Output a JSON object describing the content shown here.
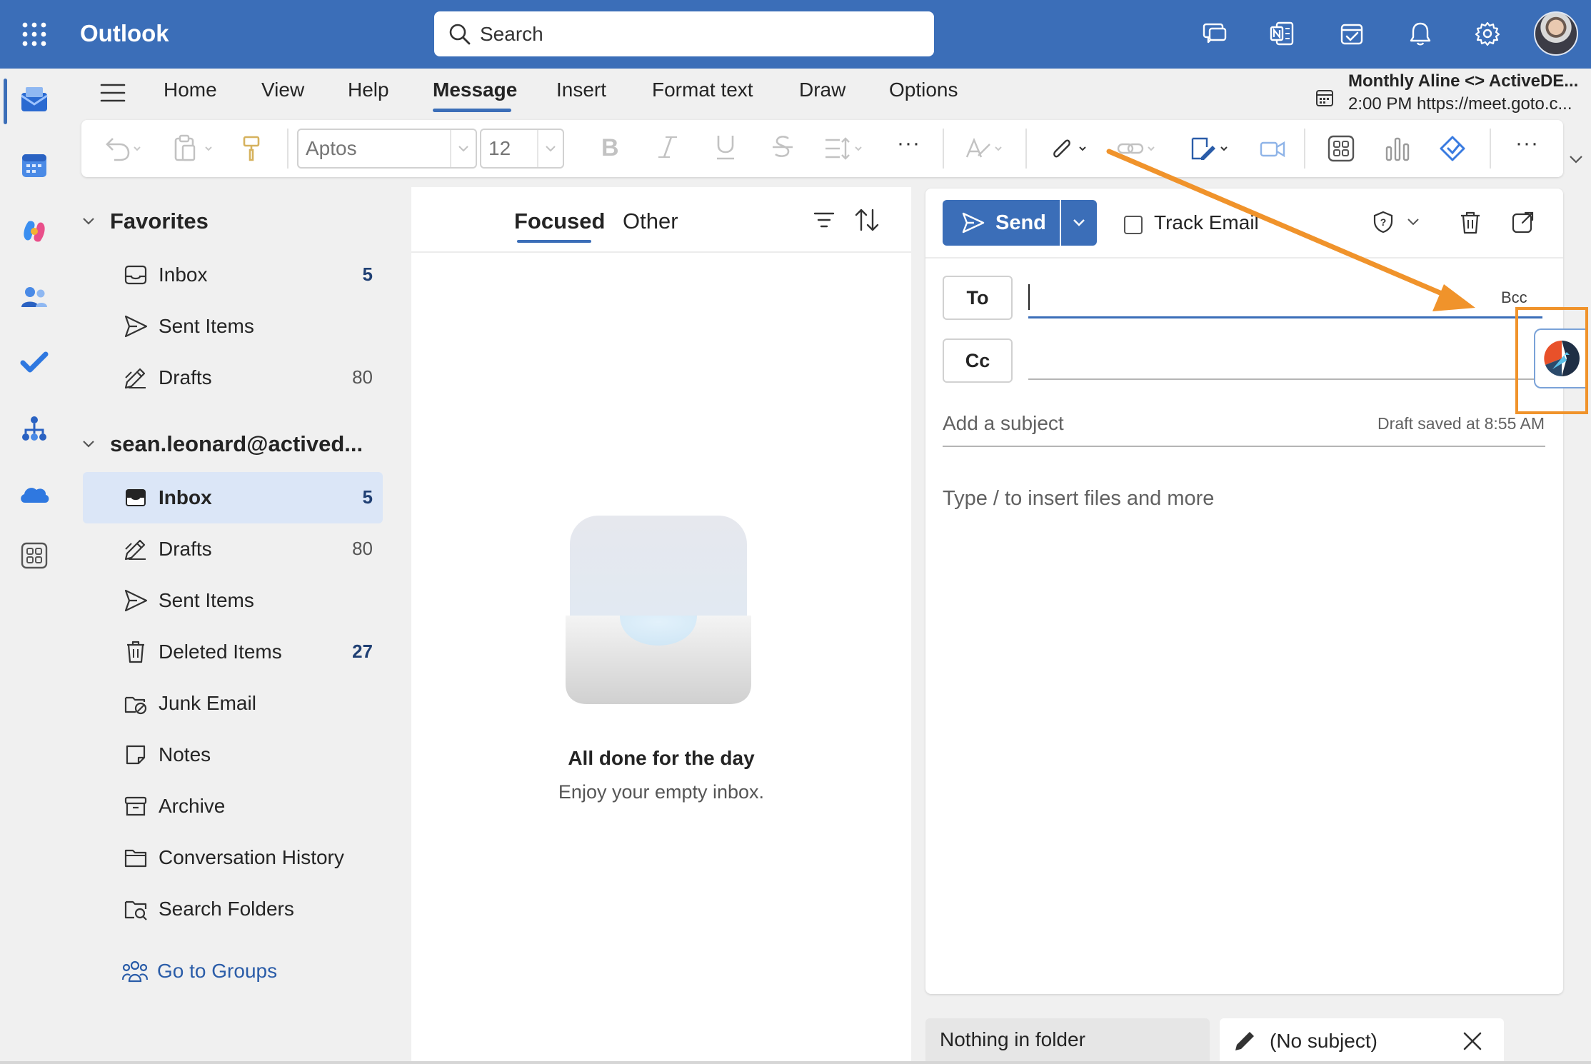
{
  "app": {
    "title": "Outlook"
  },
  "search": {
    "placeholder": "Search"
  },
  "topbar_icons": [
    "teams-chat-icon",
    "onenote-icon",
    "my-day-icon",
    "bell-icon",
    "gear-icon"
  ],
  "ribbon": {
    "tabs": [
      "Home",
      "View",
      "Help",
      "Message",
      "Insert",
      "Format text",
      "Draw",
      "Options"
    ],
    "active_tab": "Message",
    "font_name_placeholder": "Aptos",
    "font_size_placeholder": "12",
    "more_label": "···"
  },
  "meeting": {
    "title": "Monthly Aline <> ActiveDE...",
    "detail": "2:00 PM https://meet.goto.c..."
  },
  "folders": {
    "favorites_header": "Favorites",
    "favorites": [
      {
        "label": "Inbox",
        "count": "5"
      },
      {
        "label": "Sent Items",
        "count": ""
      },
      {
        "label": "Drafts",
        "count": "80"
      }
    ],
    "account_header": "sean.leonard@actived...",
    "account": [
      {
        "label": "Inbox",
        "count": "5"
      },
      {
        "label": "Drafts",
        "count": "80"
      },
      {
        "label": "Sent Items",
        "count": ""
      },
      {
        "label": "Deleted Items",
        "count": "27"
      },
      {
        "label": "Junk Email",
        "count": ""
      },
      {
        "label": "Notes",
        "count": ""
      },
      {
        "label": "Archive",
        "count": ""
      },
      {
        "label": "Conversation History",
        "count": ""
      },
      {
        "label": "Search Folders",
        "count": ""
      }
    ],
    "go_to_groups": "Go to Groups"
  },
  "message_list": {
    "tab_focused": "Focused",
    "tab_other": "Other",
    "empty_title": "All done for the day",
    "empty_subtitle": "Enjoy your empty inbox."
  },
  "compose": {
    "send_label": "Send",
    "track_email_label": "Track Email",
    "to_label": "To",
    "cc_label": "Cc",
    "bcc_label": "Bcc",
    "subject_placeholder": "Add a subject",
    "draft_saved": "Draft saved at 8:55 AM",
    "body_placeholder": "Type / to insert files and more"
  },
  "bottom_tabs": {
    "folder_status": "Nothing in folder",
    "draft_tab": "(No subject)"
  },
  "colors": {
    "brand": "#3b6eb8",
    "annotation": "#f0932b"
  }
}
